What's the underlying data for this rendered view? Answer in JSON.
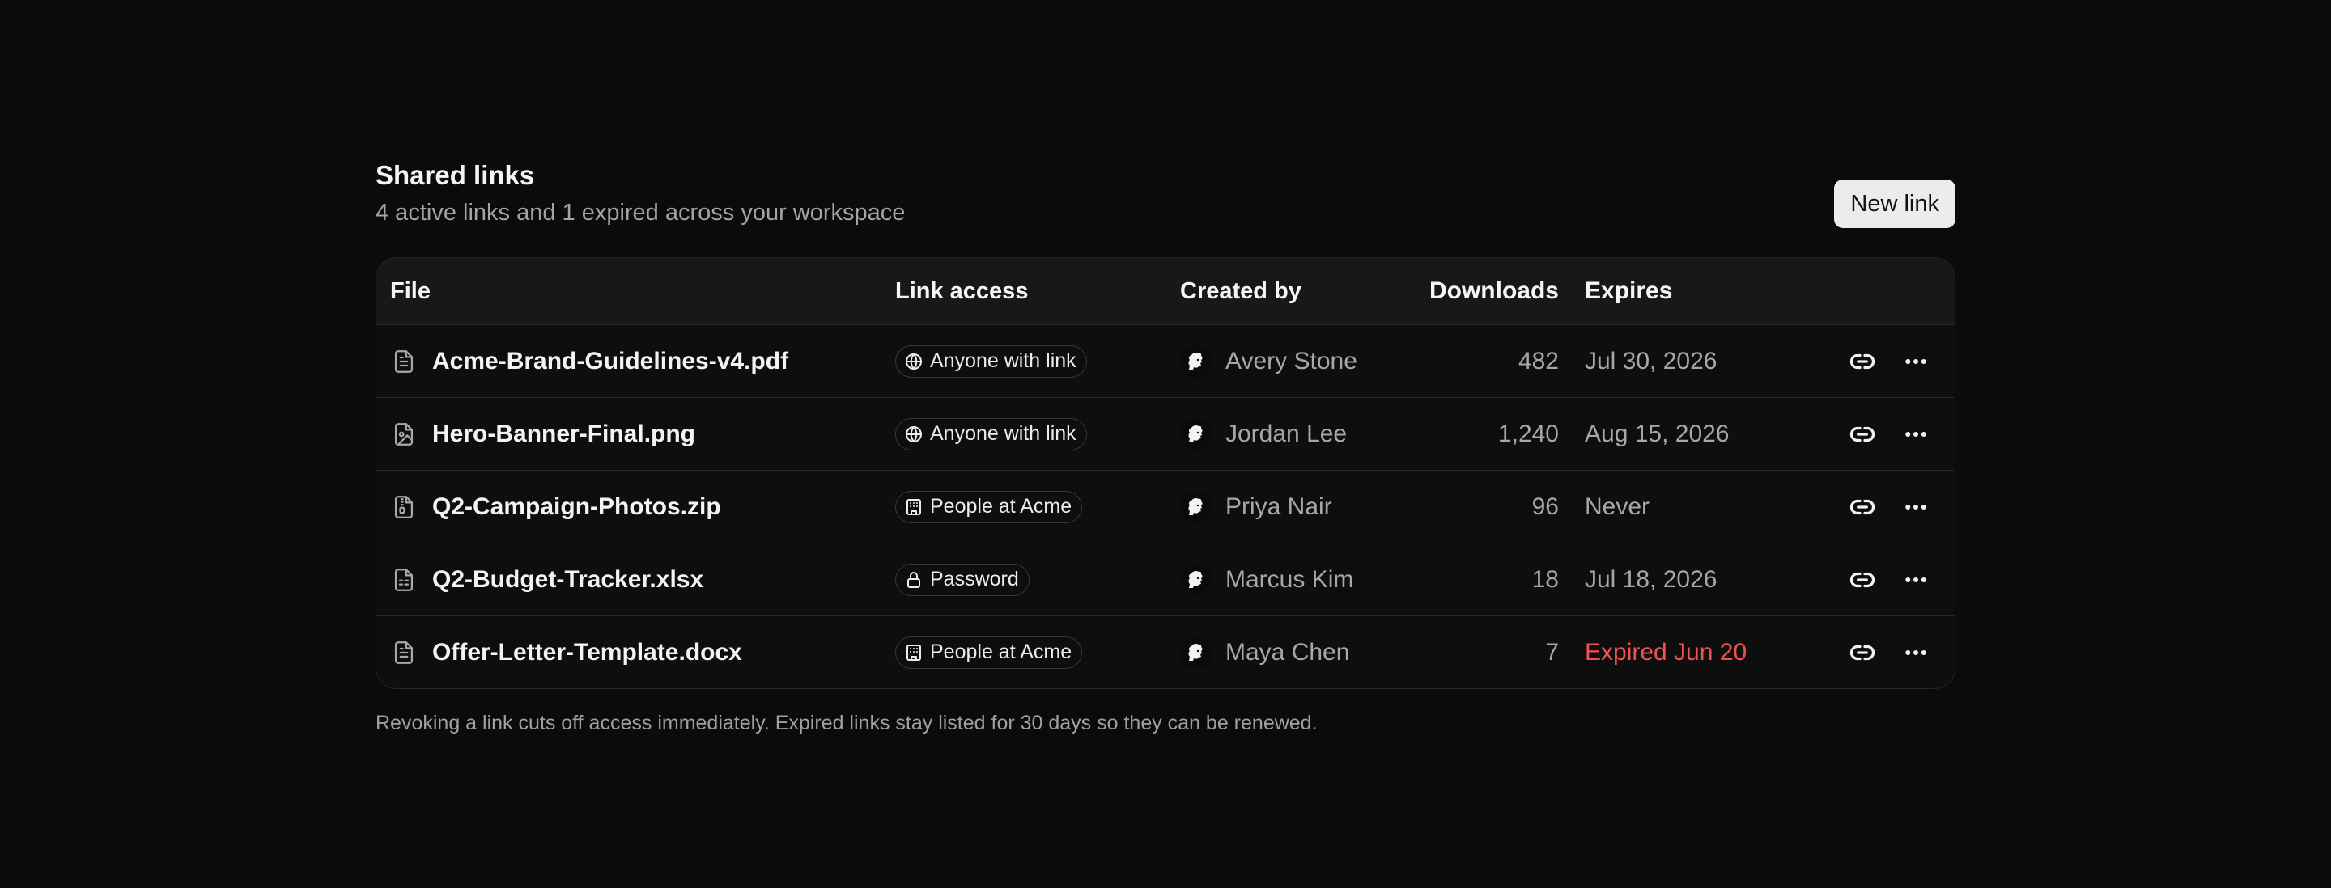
{
  "header": {
    "title": "Shared links",
    "subtitle": "4 active links and 1 expired across your workspace",
    "new_link_label": "New link"
  },
  "columns": {
    "file": "File",
    "link_access": "Link access",
    "created_by": "Created by",
    "downloads": "Downloads",
    "expires": "Expires"
  },
  "rows": [
    {
      "file_name": "Acme-Brand-Guidelines-v4.pdf",
      "file_icon": "document-icon",
      "access": "Anyone with link",
      "access_icon": "globe-icon",
      "creator": "Avery Stone",
      "downloads": "482",
      "expires": "Jul 30, 2026",
      "expired": false
    },
    {
      "file_name": "Hero-Banner-Final.png",
      "file_icon": "image-file-icon",
      "access": "Anyone with link",
      "access_icon": "globe-icon",
      "creator": "Jordan Lee",
      "downloads": "1,240",
      "expires": "Aug 15, 2026",
      "expired": false
    },
    {
      "file_name": "Q2-Campaign-Photos.zip",
      "file_icon": "archive-file-icon",
      "access": "People at Acme",
      "access_icon": "building-icon",
      "creator": "Priya Nair",
      "downloads": "96",
      "expires": "Never",
      "expired": false
    },
    {
      "file_name": "Q2-Budget-Tracker.xlsx",
      "file_icon": "spreadsheet-file-icon",
      "access": "Password",
      "access_icon": "lock-icon",
      "creator": "Marcus Kim",
      "downloads": "18",
      "expires": "Jul 18, 2026",
      "expired": false
    },
    {
      "file_name": "Offer-Letter-Template.docx",
      "file_icon": "document-icon",
      "access": "People at Acme",
      "access_icon": "building-icon",
      "creator": "Maya Chen",
      "downloads": "7",
      "expires": "Expired Jun 20",
      "expired": true
    }
  ],
  "footnote": "Revoking a link cuts off access immediately. Expired links stay listed for 30 days so they can be renewed.",
  "colors": {
    "background": "#0b0b0b",
    "expired": "#f05252",
    "muted_text": "#a7a7a7",
    "button_bg": "#ececec"
  }
}
